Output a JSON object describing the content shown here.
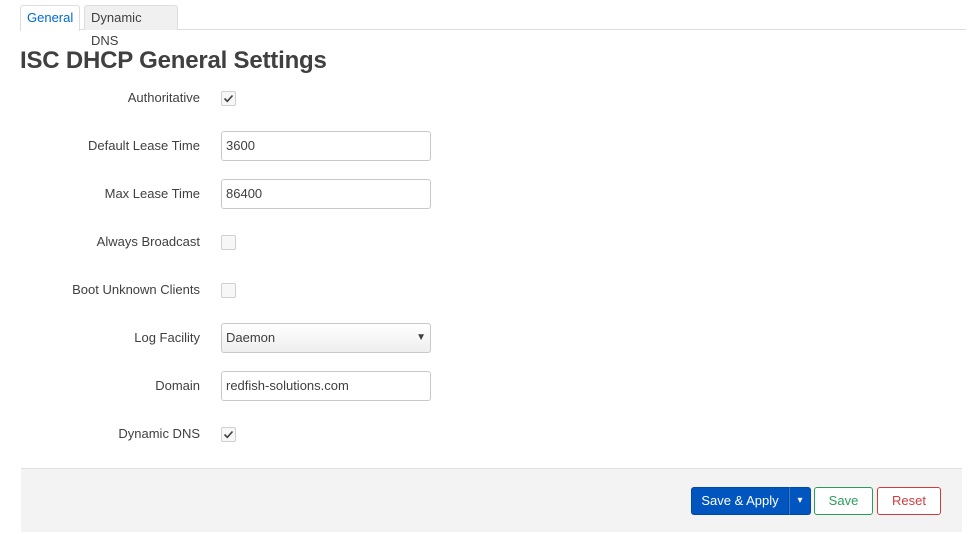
{
  "tabs": [
    {
      "label": "General",
      "active": true
    },
    {
      "label": "Dynamic DNS",
      "active": false
    }
  ],
  "page_title": "ISC DHCP General Settings",
  "fields": {
    "authoritative": {
      "label": "Authoritative",
      "checked": true
    },
    "default_lease_time": {
      "label": "Default Lease Time",
      "value": "3600"
    },
    "max_lease_time": {
      "label": "Max Lease Time",
      "value": "86400"
    },
    "always_broadcast": {
      "label": "Always Broadcast",
      "checked": false
    },
    "boot_unknown_clients": {
      "label": "Boot Unknown Clients",
      "checked": false
    },
    "log_facility": {
      "label": "Log Facility",
      "selected": "Daemon"
    },
    "domain": {
      "label": "Domain",
      "value": "redfish-solutions.com"
    },
    "dynamic_dns": {
      "label": "Dynamic DNS",
      "checked": true
    }
  },
  "actions": {
    "save_apply_label": "Save & Apply",
    "dropdown_glyph": "▾",
    "save_label": "Save",
    "reset_label": "Reset"
  },
  "colors": {
    "accent": "#0069d6",
    "primary_button": "#0055bf",
    "save_green": "#2a9d5a",
    "reset_red": "#d23c3c"
  }
}
